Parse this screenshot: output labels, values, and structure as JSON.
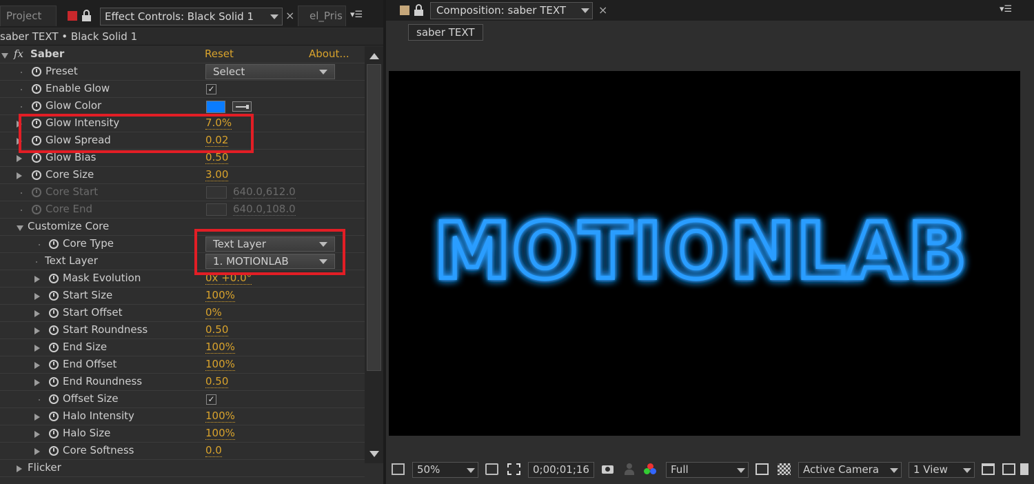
{
  "left_panel": {
    "tabs": {
      "project": "Project",
      "effect_controls": "Effect Controls: Black Solid 1",
      "third": "el_Pris"
    },
    "breadcrumb": "saber TEXT • Black Solid 1",
    "effect": {
      "fx_label": "fx",
      "name": "Saber",
      "reset": "Reset",
      "about": "About..."
    },
    "properties": [
      {
        "label": "Preset",
        "value": "Select",
        "kind": "dropdown"
      },
      {
        "label": "Enable Glow",
        "kind": "checkbox",
        "checked": true
      },
      {
        "label": "Glow Color",
        "kind": "color",
        "color": "#0a7cff"
      },
      {
        "label": "Glow Intensity",
        "value": "7.0%"
      },
      {
        "label": "Glow Spread",
        "value": "0.02"
      },
      {
        "label": "Glow Bias",
        "value": "0.50"
      },
      {
        "label": "Core Size",
        "value": "3.00"
      },
      {
        "label": "Core Start",
        "value": "640.0,612.0",
        "disabled": true
      },
      {
        "label": "Core End",
        "value": "640.0,108.0",
        "disabled": true
      },
      {
        "label": "Customize Core",
        "kind": "group"
      },
      {
        "label": "Core Type",
        "value": "Text Layer",
        "kind": "dropdown"
      },
      {
        "label": "Text Layer",
        "value": "1. MOTIONLAB",
        "kind": "dropdown"
      },
      {
        "label": "Mask Evolution",
        "value": "0x +0.0°"
      },
      {
        "label": "Start Size",
        "value": "100%"
      },
      {
        "label": "Start Offset",
        "value": "0%"
      },
      {
        "label": "Start Roundness",
        "value": "0.50"
      },
      {
        "label": "End Size",
        "value": "100%"
      },
      {
        "label": "End Offset",
        "value": "100%"
      },
      {
        "label": "End Roundness",
        "value": "0.50"
      },
      {
        "label": "Offset Size",
        "kind": "checkbox",
        "checked": true
      },
      {
        "label": "Halo Intensity",
        "value": "100%"
      },
      {
        "label": "Halo Size",
        "value": "100%"
      },
      {
        "label": "Core Softness",
        "value": "0.0"
      },
      {
        "label": "Flicker",
        "kind": "group"
      }
    ]
  },
  "right_panel": {
    "tab_title": "Composition: saber TEXT",
    "flowchart_chip": "saber TEXT",
    "viewer_text": "MOTIONLAB",
    "glow_color": "#2a9dff",
    "bottom_bar": {
      "zoom": "50%",
      "timecode": "0;00;01;16",
      "resolution": "Full",
      "camera": "Active Camera",
      "views": "1 View"
    }
  },
  "accent_colors": {
    "value_orange": "#d9a32c",
    "highlight_red": "#e21e25"
  }
}
